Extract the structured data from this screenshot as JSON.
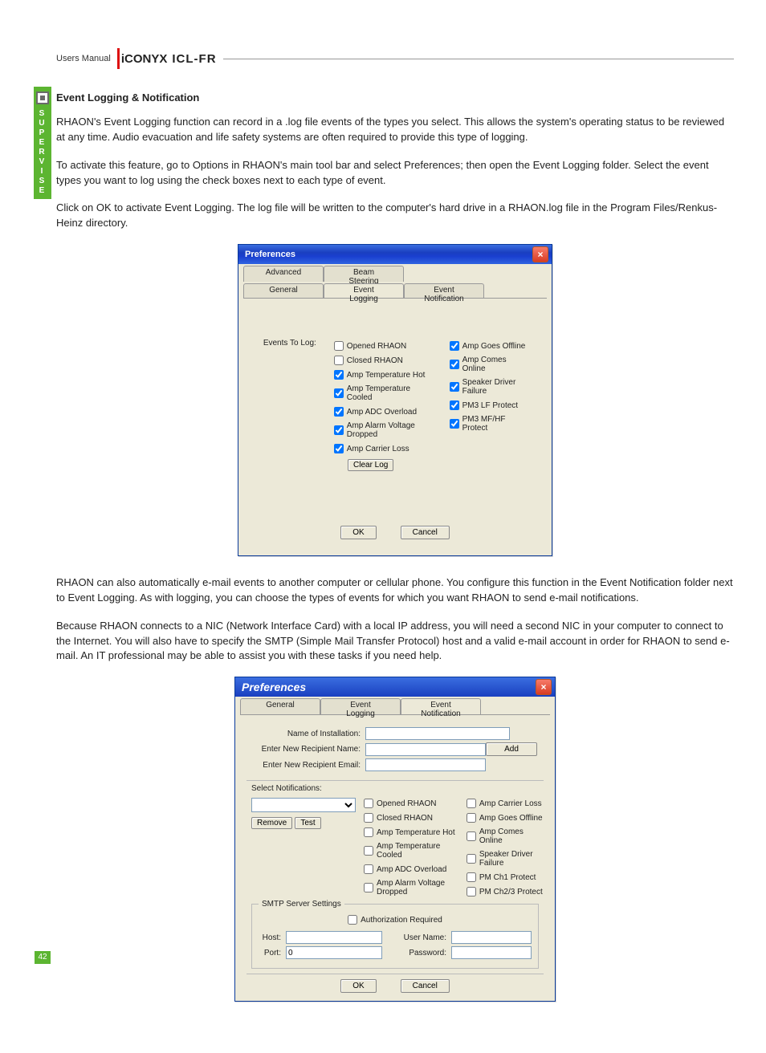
{
  "header": {
    "manual_label": "Users Manual",
    "logo_main": "iCONYX",
    "logo_model": "ICL-FR"
  },
  "sidetab": {
    "letters": [
      "S",
      "U",
      "P",
      "E",
      "R",
      "V",
      "I",
      "S",
      "E"
    ]
  },
  "page_number": "42",
  "section_title": "Event Logging & Notification",
  "paragraphs": {
    "p1": "RHAON's Event Logging function can record in a .log file events of the types you select. This allows the system's operating status to be reviewed at any time. Audio evacuation and life safety systems are often required to provide this type of logging.",
    "p2": "To activate this feature, go to Options in RHAON's main tool bar and select Preferences; then open the Event Logging folder. Select the event types you want to log using the check boxes next to each type of event.",
    "p3": "Click on OK to activate Event Logging. The log file will be written to the computer's hard drive in a RHAON.log file in the Program Files/Renkus-Heinz directory.",
    "p4": "RHAON can also automatically e-mail events to another computer or cellular phone. You configure this function in the Event Notification folder next to Event Logging. As with logging, you can choose the types of events for which you want RHAON to send e-mail notifications.",
    "p5": "Because RHAON connects to a NIC (Network Interface Card) with a local IP address, you will need a second NIC in your computer to connect to the Internet. You will also have to specify the SMTP (Simple Mail Transfer Protocol) host and a valid e-mail account in order for RHAON to send e-mail. An IT professional may be able to assist you with these tasks if you need help."
  },
  "dialog1": {
    "title": "Preferences",
    "tabs_top": {
      "left": "Advanced",
      "right": "Beam Steering"
    },
    "tabs_bottom": {
      "left": "General",
      "mid": "Event Logging",
      "right": "Event Notification"
    },
    "events_label": "Events To Log:",
    "col1": [
      {
        "label": "Opened RHAON",
        "checked": false
      },
      {
        "label": "Closed RHAON",
        "checked": false
      },
      {
        "label": "Amp Temperature Hot",
        "checked": true
      },
      {
        "label": "Amp Temperature Cooled",
        "checked": true
      },
      {
        "label": "Amp ADC Overload",
        "checked": true
      },
      {
        "label": "Amp Alarm Voltage Dropped",
        "checked": true
      },
      {
        "label": "Amp Carrier Loss",
        "checked": true
      }
    ],
    "col2": [
      {
        "label": "Amp Goes Offline",
        "checked": true
      },
      {
        "label": "Amp Comes Online",
        "checked": true
      },
      {
        "label": "Speaker Driver Failure",
        "checked": true
      },
      {
        "label": "PM3 LF Protect",
        "checked": true
      },
      {
        "label": "PM3 MF/HF Protect",
        "checked": true
      }
    ],
    "clear_log": "Clear Log",
    "ok": "OK",
    "cancel": "Cancel"
  },
  "dialog2": {
    "title": "Preferences",
    "tabs": {
      "left": "General",
      "mid": "Event Logging",
      "right": "Event Notification"
    },
    "fields": {
      "name_install": "Name of Installation:",
      "recip_name": "Enter New Recipient Name:",
      "recip_email": "Enter New Recipient Email:",
      "add": "Add",
      "select_notif": "Select Notifications:",
      "remove": "Remove",
      "test": "Test"
    },
    "notif_col1": [
      {
        "label": "Opened RHAON",
        "checked": false
      },
      {
        "label": "Closed RHAON",
        "checked": false
      },
      {
        "label": "Amp Temperature Hot",
        "checked": false
      },
      {
        "label": "Amp Temperature Cooled",
        "checked": false
      },
      {
        "label": "Amp ADC Overload",
        "checked": false
      },
      {
        "label": "Amp Alarm Voltage Dropped",
        "checked": false
      }
    ],
    "notif_col2": [
      {
        "label": "Amp Carrier Loss",
        "checked": false
      },
      {
        "label": "Amp Goes Offline",
        "checked": false
      },
      {
        "label": "Amp Comes Online",
        "checked": false
      },
      {
        "label": "Speaker Driver Failure",
        "checked": false
      },
      {
        "label": "PM Ch1 Protect",
        "checked": false
      },
      {
        "label": "PM Ch2/3 Protect",
        "checked": false
      }
    ],
    "smtp": {
      "group": "SMTP Server Settings",
      "auth": "Authorization Required",
      "host_label": "Host:",
      "port_label": "Port:",
      "port_value": "0",
      "user_label": "User Name:",
      "pass_label": "Password:"
    },
    "ok": "OK",
    "cancel": "Cancel"
  }
}
